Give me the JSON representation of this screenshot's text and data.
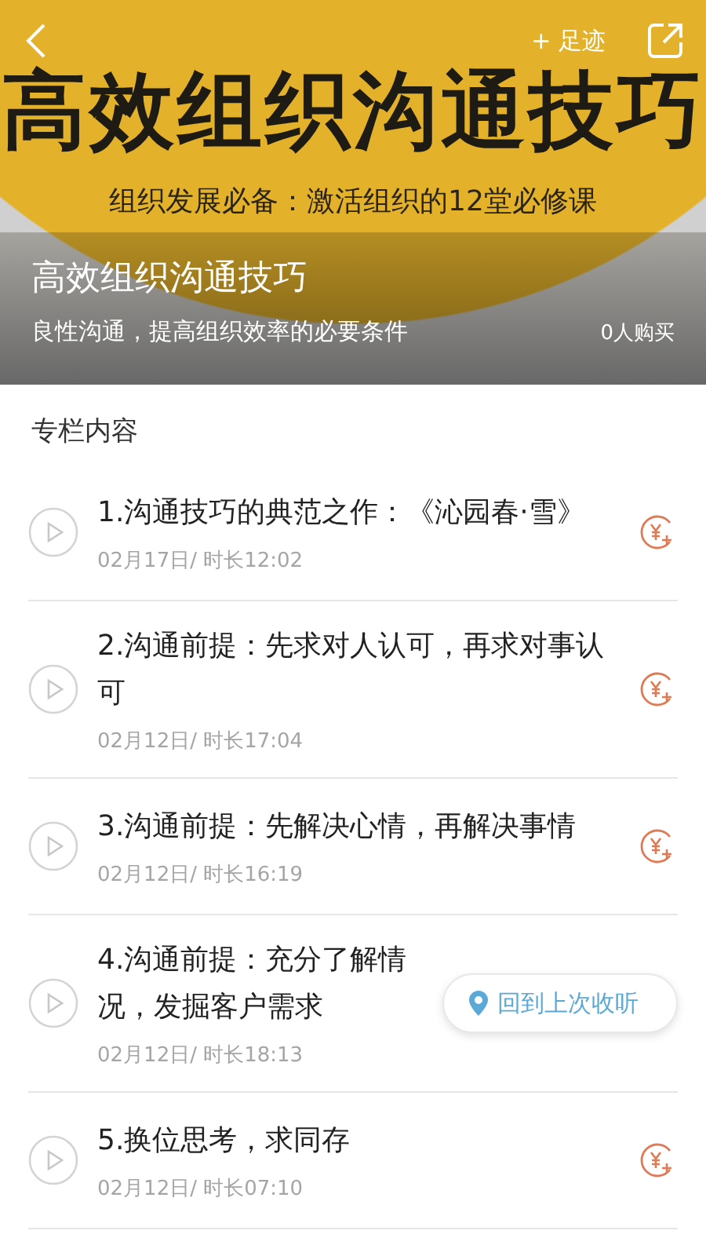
{
  "top_bar": {
    "footprint_label": "+ 足迹"
  },
  "cover": {
    "headline": "高效组织沟通技巧",
    "tagline": "组织发展必备：激活组织的12堂必修课"
  },
  "course": {
    "title": "高效组织沟通技巧",
    "subtitle": "良性沟通，提高组织效率的必要条件",
    "buyers": "0人购买"
  },
  "section_title": "专栏内容",
  "lessons": [
    {
      "title": "1.沟通技巧的典范之作：《沁园春·雪》",
      "meta": "02月17日/ 时长12:02",
      "price_tag": true
    },
    {
      "title": "2.沟通前提：先求对人认可，再求对事认可",
      "meta": "02月12日/ 时长17:04",
      "price_tag": true
    },
    {
      "title": "3.沟通前提：先解决心情，再解决事情",
      "meta": "02月12日/ 时长16:19",
      "price_tag": true
    },
    {
      "title": "4.沟通前提：充分了解情况，发掘客户需求",
      "meta": "02月12日/ 时长18:13",
      "price_tag": false
    },
    {
      "title": "5.换位思考，求同存",
      "meta": "02月12日/ 时长07:10",
      "price_tag": true
    }
  ],
  "resume_button": "回到上次收听"
}
